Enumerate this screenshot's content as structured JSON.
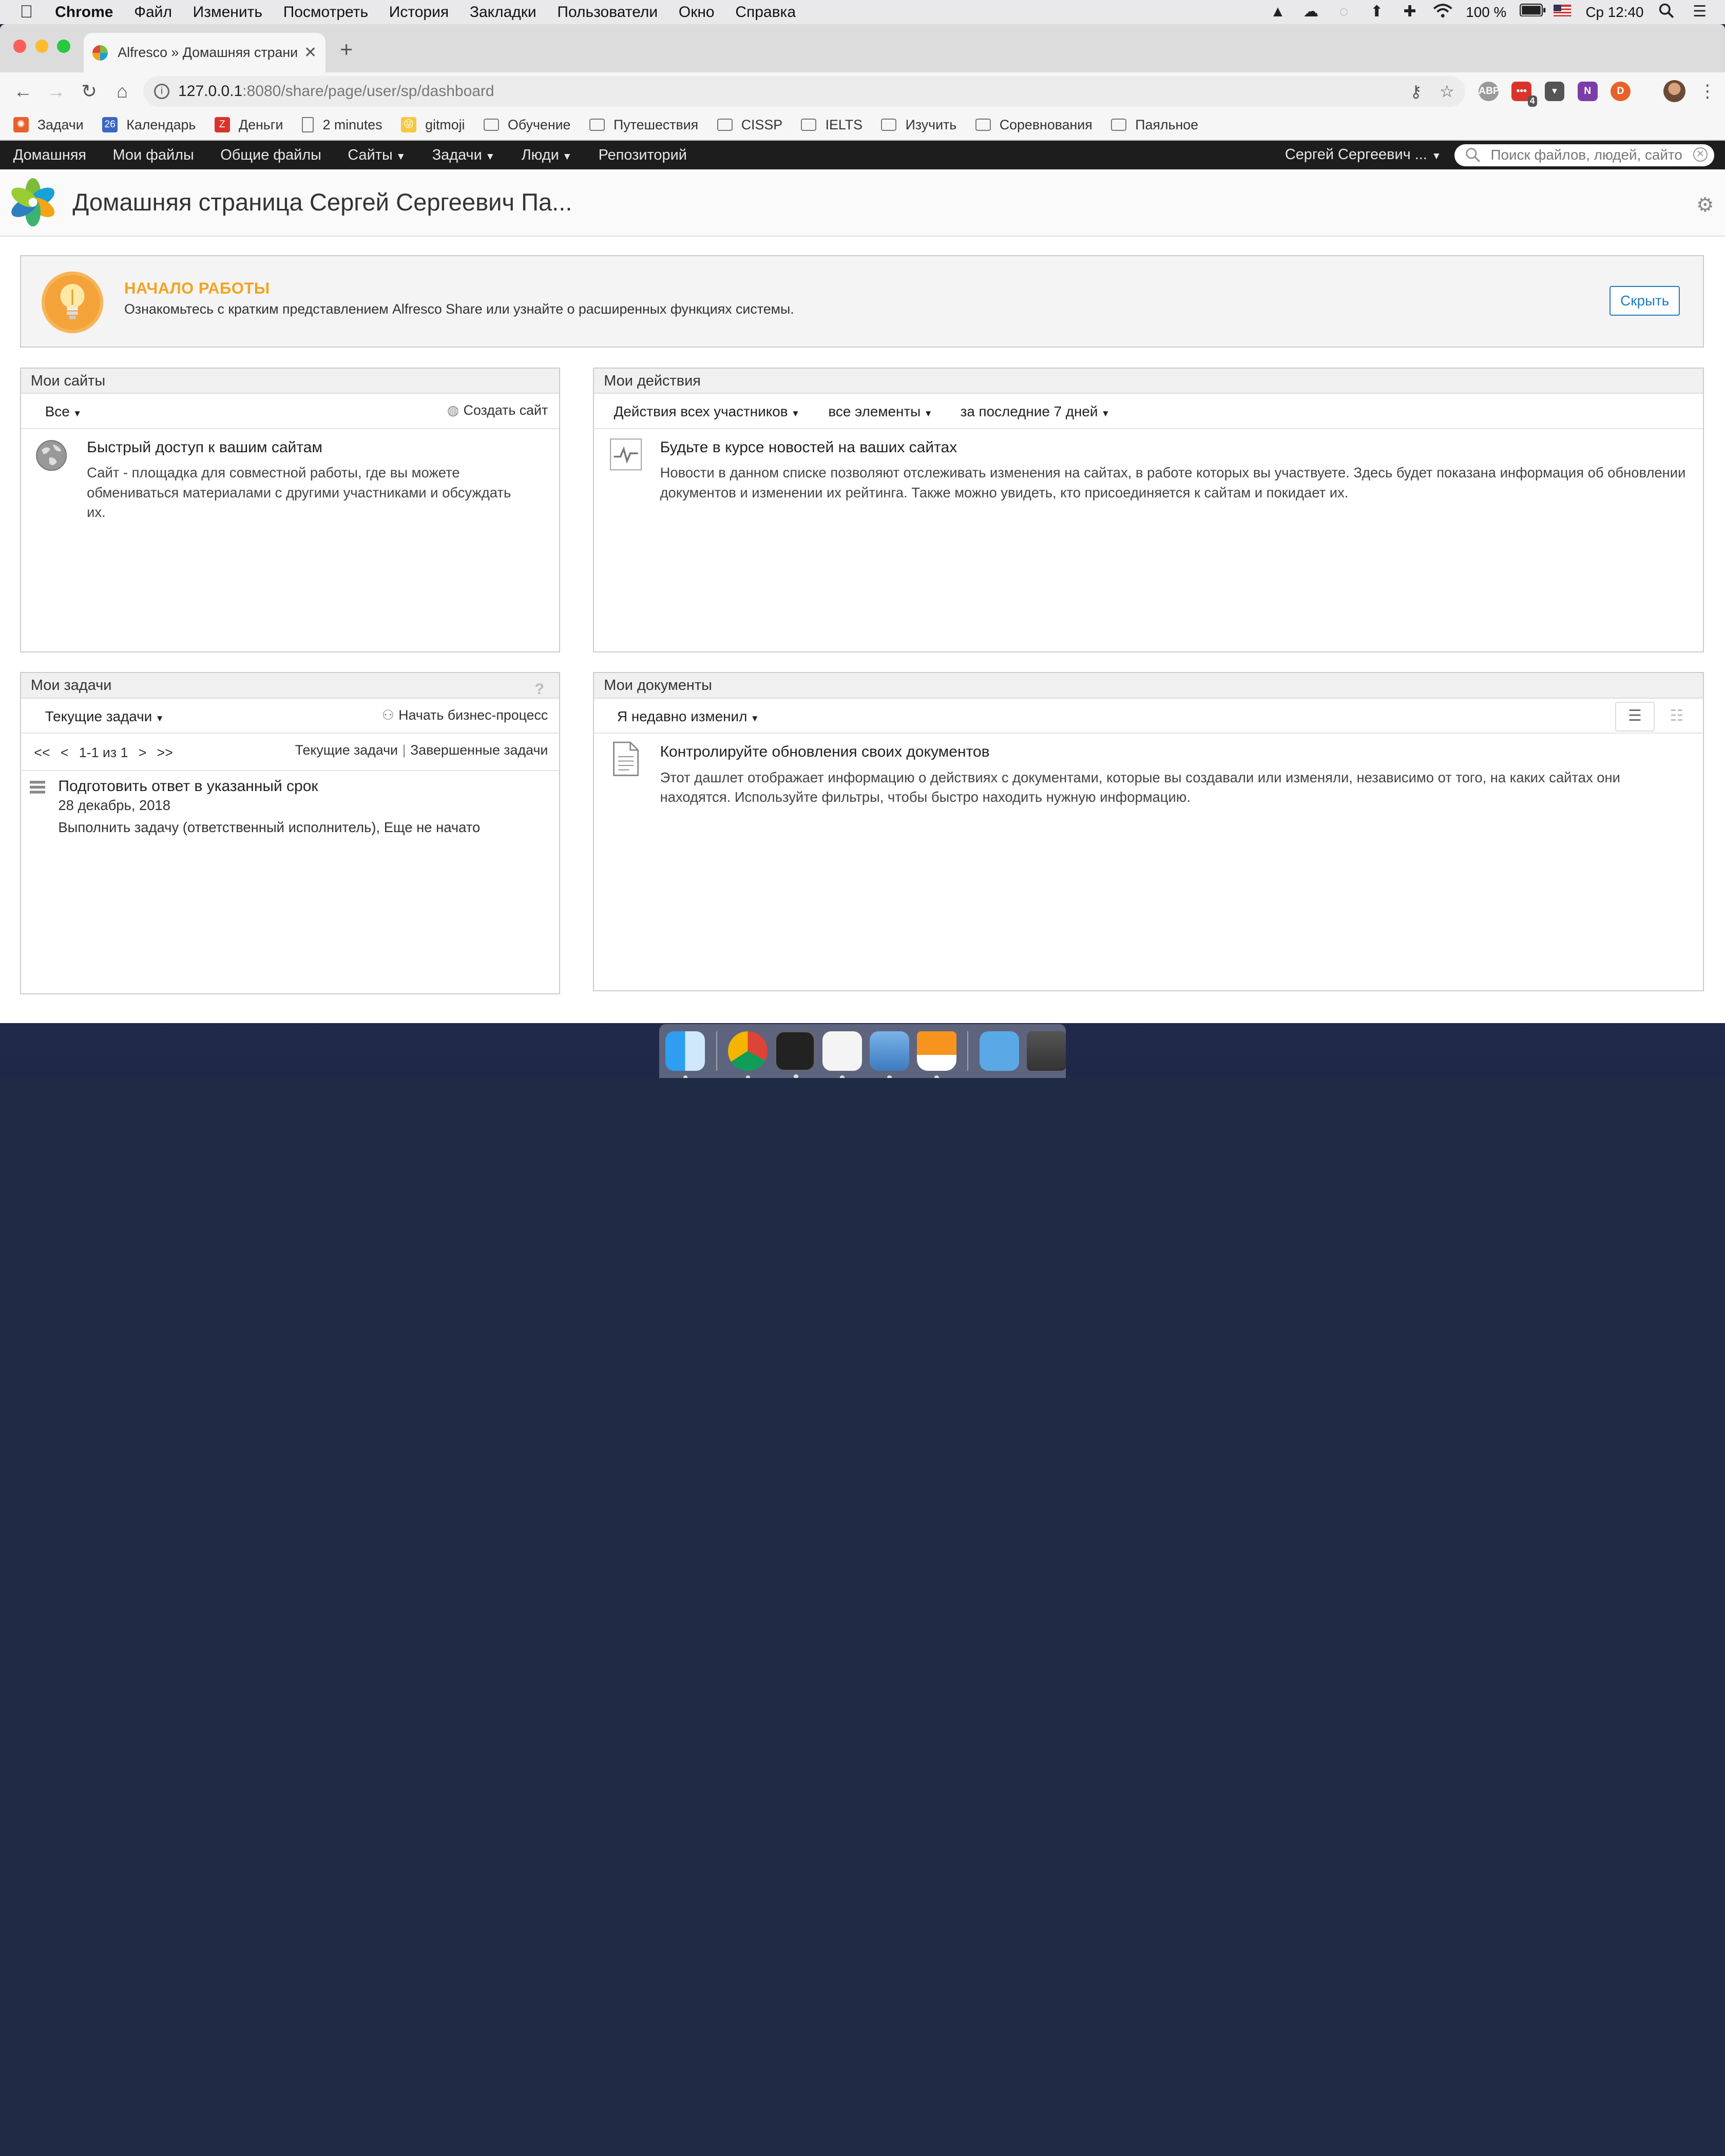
{
  "os_menubar": {
    "app": "Chrome",
    "items": [
      "Файл",
      "Изменить",
      "Посмотреть",
      "История",
      "Закладки",
      "Пользователи",
      "Окно",
      "Справка"
    ],
    "battery": "100 %",
    "clock": "Ср 12:40"
  },
  "browser": {
    "tab_title": "Alfresco » Домашняя страни",
    "url_host": "127.0.0.1",
    "url_path": ":8080/share/page/user/sp/dashboard",
    "ext_badge": "4",
    "bookmarks": [
      {
        "label": "Задачи",
        "icon": "tasks-icon",
        "color": "#e8612c"
      },
      {
        "label": "Календарь",
        "icon": "calendar-icon",
        "color": "#3b66c4",
        "text": "26"
      },
      {
        "label": "Деньги",
        "icon": "money-icon",
        "color": "#d9342b",
        "text": "Z"
      },
      {
        "label": "2 minutes",
        "icon": "page-icon"
      },
      {
        "label": "gitmoji",
        "icon": "gitmoji-icon",
        "color": "#f5c842",
        "text": "😜"
      },
      {
        "label": "Обучение",
        "icon": "folder-icon"
      },
      {
        "label": "Путешествия",
        "icon": "folder-icon"
      },
      {
        "label": "CISSP",
        "icon": "folder-icon"
      },
      {
        "label": "IELTS",
        "icon": "folder-icon"
      },
      {
        "label": "Изучить",
        "icon": "folder-icon"
      },
      {
        "label": "Соревнования",
        "icon": "folder-icon"
      },
      {
        "label": "Паяльное",
        "icon": "folder-icon"
      }
    ]
  },
  "app": {
    "nav": [
      {
        "label": "Домашняя",
        "dropdown": false
      },
      {
        "label": "Мои файлы",
        "dropdown": false
      },
      {
        "label": "Общие файлы",
        "dropdown": false
      },
      {
        "label": "Сайты",
        "dropdown": true
      },
      {
        "label": "Задачи",
        "dropdown": true
      },
      {
        "label": "Люди",
        "dropdown": true
      },
      {
        "label": "Репозиторий",
        "dropdown": false
      }
    ],
    "user_menu": "Сергей Сергеевич ...",
    "search_placeholder": "Поиск файлов, людей, сайто",
    "page_title": "Домашняя страница Сергей Сергеевич Па..."
  },
  "welcome": {
    "title": "НАЧАЛО РАБОТЫ",
    "text": "Ознакомьтесь с кратким представлением Alfresco Share или узнайте о расширенных функциях системы.",
    "hide_button": "Скрыть"
  },
  "my_sites": {
    "title": "Мои сайты",
    "filter": "Все",
    "create_action": "Создать сайт",
    "empty_title": "Быстрый доступ к вашим сайтам",
    "empty_text": "Сайт - площадка для совместной работы, где вы можете обмениваться материалами с другими участниками и обсуждать их."
  },
  "my_activities": {
    "title": "Мои действия",
    "filter_who": "Действия всех участников",
    "filter_what": "все элементы",
    "filter_when": "за последние 7 дней",
    "empty_title": "Будьте в курсе новостей на ваших сайтах",
    "empty_text": "Новости в данном списке позволяют отслеживать изменения на сайтах, в работе которых вы участвуете. Здесь будет показана информация об обновлении документов и изменении их рейтинга. Также можно увидеть, кто присоединяется к сайтам и покидает их."
  },
  "my_tasks": {
    "title": "Мои задачи",
    "help": "?",
    "filter": "Текущие задачи",
    "start_action": "Начать бизнес-процесс",
    "pager": {
      "first": "<<",
      "prev": "<",
      "info": "1-1 из 1",
      "next": ">",
      "last": ">>"
    },
    "tab_active": "Текущие задачи",
    "tab_completed": "Завершенные задачи",
    "items": [
      {
        "title": "Подготовить ответ в указанный срок",
        "due": "28 декабрь, 2018",
        "status": "Выполнить задачу (ответственный исполнитель), Еще не начато"
      }
    ]
  },
  "my_documents": {
    "title": "Мои документы",
    "filter": "Я недавно изменил",
    "empty_title": "Контролируйте обновления своих документов",
    "empty_text": "Этот дашлет отображает информацию о действиях с документами, которые вы создавали или изменяли, независимо от того, на каких сайтах они находятся. Используйте фильтры, чтобы быстро находить нужную информацию."
  },
  "colors": {
    "accent_orange": "#f2a322",
    "link_blue": "#1c7dbf",
    "header_dark": "#1d1d1d"
  }
}
